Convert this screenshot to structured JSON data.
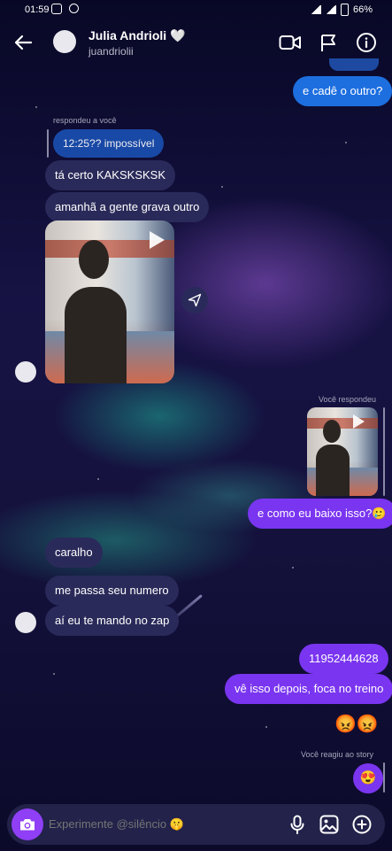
{
  "status_bar": {
    "time": "01:59",
    "battery": "66%"
  },
  "header": {
    "name": "Julia Andrioli 🤍",
    "username": "juandriolii"
  },
  "messages": {
    "sent_1": "e cadê o outro?",
    "reply_meta_1": "respondeu a você",
    "quoted_1": "12:25?? impossível",
    "recv_1": "tá certo KAKSKSKSK",
    "recv_2": "amanhã a gente grava outro",
    "reply_meta_2": "Você respondeu",
    "sent_2": "e como eu baixo isso?🥲",
    "recv_3": "caralho",
    "recv_4": "me passa seu numero",
    "recv_5": "aí eu te mando no zap",
    "sent_3": "11952444628",
    "sent_4": "vê isso depois, foca no treino",
    "emoji_reactions": "😡😡",
    "story_meta": "Você reagiu ao story",
    "story_reaction": "😍"
  },
  "composer": {
    "placeholder": "Experimente @silêncio 🤫"
  },
  "colors": {
    "received": "#2a2a5a",
    "sent_blue": "#1d6fe0",
    "sent_purple": "#7a35f0",
    "camera": "#8f3ff5"
  },
  "icons": [
    "back-arrow-icon",
    "video-call-icon",
    "flag-icon",
    "info-icon",
    "share-icon",
    "play-icon",
    "camera-icon",
    "microphone-icon",
    "gallery-icon",
    "plus-icon"
  ]
}
